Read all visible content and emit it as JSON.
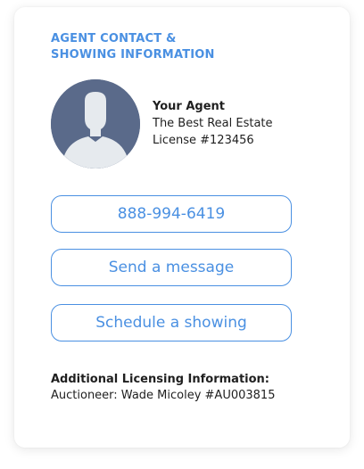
{
  "section_title": {
    "line1": "AGENT CONTACT &",
    "line2": "SHOWING INFORMATION"
  },
  "agent": {
    "avatar_icon": "user-silhouette-icon",
    "name": "Your Agent",
    "company": "The Best Real Estate",
    "license": "License #123456"
  },
  "buttons": {
    "phone": "888-994-6419",
    "message": "Send a message",
    "showing": "Schedule a showing"
  },
  "licensing": {
    "title": "Additional Licensing Information:",
    "detail": "Auctioneer: Wade Micoley #AU003815"
  },
  "colors": {
    "accent": "#4a90e2",
    "avatar_background": "#5a6a8a",
    "avatar_silhouette": "#e6eaee"
  }
}
